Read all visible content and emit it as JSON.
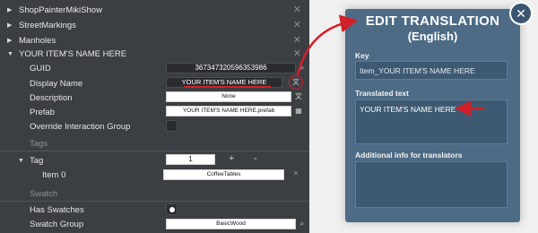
{
  "inspector": {
    "list_items": [
      {
        "label": "ShopPainterMikiShow",
        "close": "✕"
      },
      {
        "label": "StreetMarkings",
        "close": "✕"
      },
      {
        "label": "Manholes",
        "close": "✕"
      },
      {
        "label": "YOUR ITEM'S NAME HERE",
        "close": "✕"
      }
    ],
    "properties": {
      "guid_label": "GUID",
      "guid_value": "3673473205963539​86",
      "display_name_label": "Display Name",
      "display_name_value": "YOUR ITEM'S NAME HERE",
      "description_label": "Description",
      "description_value": "None",
      "prefab_label": "Prefab",
      "prefab_value": "YOUR ITEM'S NAME HERE.prefab",
      "override_label": "Override Interaction Group"
    },
    "tags_section": "Tags",
    "tag": {
      "label": "Tag",
      "count": "1",
      "plus": "+",
      "minus": "-",
      "item_label": "Item 0",
      "item_value": "CoffeeTables",
      "item_close": "✕"
    },
    "swatch_section": "Swatch",
    "swatch": {
      "has_swatches_label": "Has Swatches",
      "group_label": "Swatch Group",
      "group_value": "BasicWood"
    }
  },
  "popup": {
    "title": "EDIT TRANSLATION",
    "subtitle": "(English)",
    "key_label": "Key",
    "key_value": "Item_YOUR ITEM'S NAME HERE",
    "translated_label": "Translated text",
    "translated_value": "YOUR ITEM'S NAME HERE",
    "info_label": "Additional info for translators",
    "info_value": "",
    "close_icon": "✕"
  },
  "colors": {
    "panel_bg": "#3b3e42",
    "popup_bg": "#4d6b85",
    "annotation_red": "#d1202a"
  }
}
